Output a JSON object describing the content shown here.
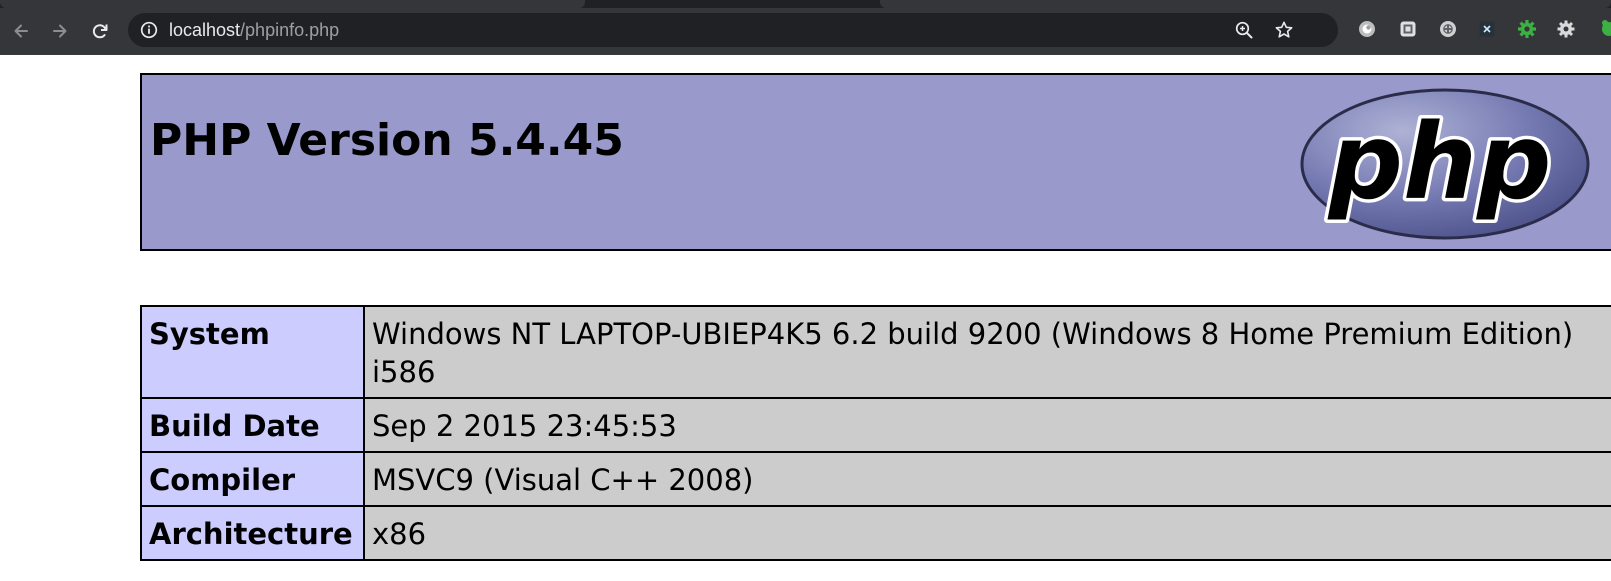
{
  "browser": {
    "address": {
      "host": "localhost",
      "path": "/phpinfo.php"
    },
    "icons": {
      "back": "back-arrow-icon",
      "forward": "forward-arrow-icon",
      "reload": "reload-icon",
      "site_info": "info-icon",
      "zoom": "zoom-in-icon",
      "bookmark": "star-icon"
    },
    "extensions": [
      "globe-extension-icon",
      "translate-extension-icon",
      "circle-extension-icon",
      "x-extension-icon",
      "green-gear-extension-icon",
      "gear-extension-icon",
      "green-extension-icon"
    ]
  },
  "phpinfo": {
    "title": "PHP Version 5.4.45",
    "logo_text": "php",
    "colors": {
      "header_bg": "#9999cc",
      "label_bg": "#ccccff",
      "value_bg": "#cccccc"
    },
    "rows": [
      {
        "label": "System",
        "value": "Windows NT LAPTOP-UBIEP4K5 6.2 build 9200 (Windows 8 Home Premium Edition) i586"
      },
      {
        "label": "Build Date",
        "value": "Sep 2 2015 23:45:53"
      },
      {
        "label": "Compiler",
        "value": "MSVC9 (Visual C++ 2008)"
      },
      {
        "label": "Architecture",
        "value": "x86"
      }
    ]
  }
}
